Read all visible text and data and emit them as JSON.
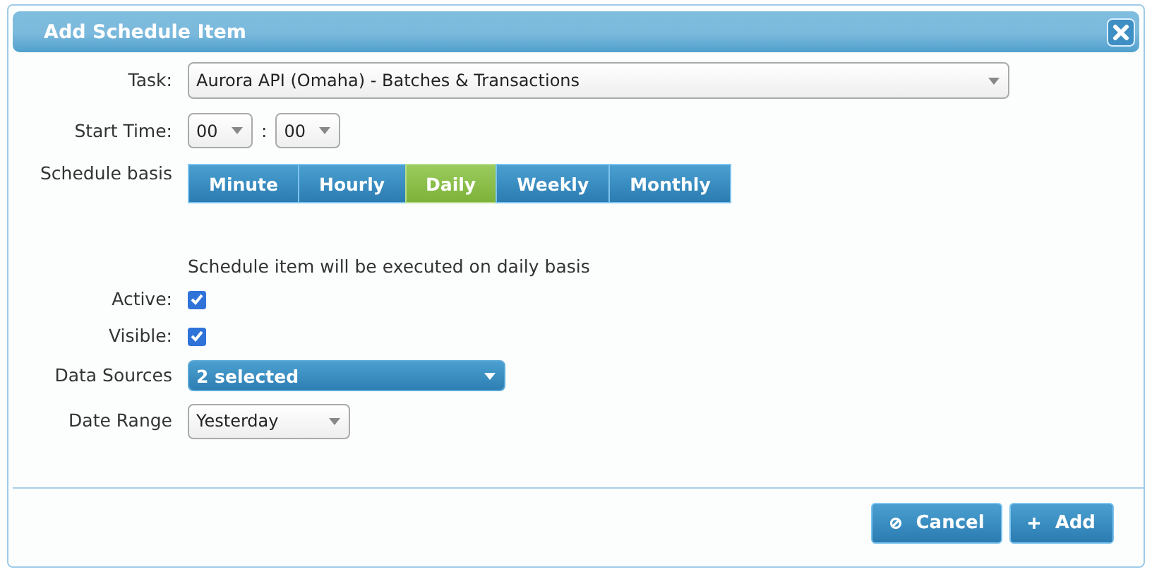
{
  "window": {
    "title": "Add Schedule Item"
  },
  "task": {
    "label": "Task:",
    "value": "Aurora API (Omaha) - Batches & Transactions"
  },
  "start_time": {
    "label": "Start Time:",
    "hour": "00",
    "separator": ":",
    "minute": "00"
  },
  "schedule_basis": {
    "label": "Schedule basis",
    "options": [
      {
        "label": "Minute",
        "selected": false
      },
      {
        "label": "Hourly",
        "selected": false
      },
      {
        "label": "Daily",
        "selected": true
      },
      {
        "label": "Weekly",
        "selected": false
      },
      {
        "label": "Monthly",
        "selected": false
      }
    ]
  },
  "description": "Schedule item will be executed on daily basis",
  "active": {
    "label": "Active:",
    "checked": true
  },
  "visible": {
    "label": "Visible:",
    "checked": true
  },
  "data_sources": {
    "label": "Data Sources",
    "value": "2 selected"
  },
  "date_range": {
    "label": "Date Range",
    "value": "Yesterday"
  },
  "buttons": [
    {
      "label": "Cancel",
      "kind": "cancel"
    },
    {
      "label": "Add",
      "kind": "add"
    }
  ]
}
